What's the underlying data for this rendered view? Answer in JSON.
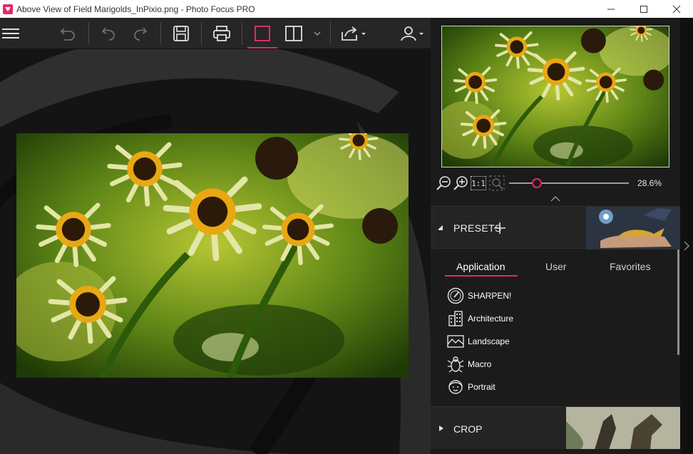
{
  "window": {
    "title": "Above View of Field Marigolds_InPixio.png - Photo Focus PRO",
    "minimize_icon": "minimize-icon",
    "maximize_icon": "maximize-icon",
    "close_icon": "close-icon"
  },
  "toolbar": {
    "items": [
      "menu-icon",
      "revert-icon",
      "undo-icon",
      "redo-icon",
      "save-icon",
      "print-icon",
      "single-view-icon",
      "split-view-icon",
      "chevron-down-icon",
      "share-icon",
      "account-icon"
    ],
    "active_item": "single-view-icon"
  },
  "colors": {
    "accent": "#e02a6b",
    "toolbar_bg": "#262626",
    "panel_bg": "#1b1b1b",
    "header_bg": "#242424"
  },
  "zoom": {
    "percent_label": "28.6%",
    "fit_label": "1:1",
    "slider_value_fraction": 0.23
  },
  "presets": {
    "title": "PRESETS",
    "tabs": [
      {
        "label": "Application",
        "active": true
      },
      {
        "label": "User",
        "active": false
      },
      {
        "label": "Favorites",
        "active": false
      }
    ],
    "items": [
      {
        "label": "SHARPEN!",
        "icon": "gauge-icon"
      },
      {
        "label": "Architecture",
        "icon": "building-icon"
      },
      {
        "label": "Landscape",
        "icon": "mountain-icon"
      },
      {
        "label": "Macro",
        "icon": "bug-icon"
      },
      {
        "label": "Portrait",
        "icon": "face-icon"
      }
    ]
  },
  "crop": {
    "title": "CROP"
  }
}
